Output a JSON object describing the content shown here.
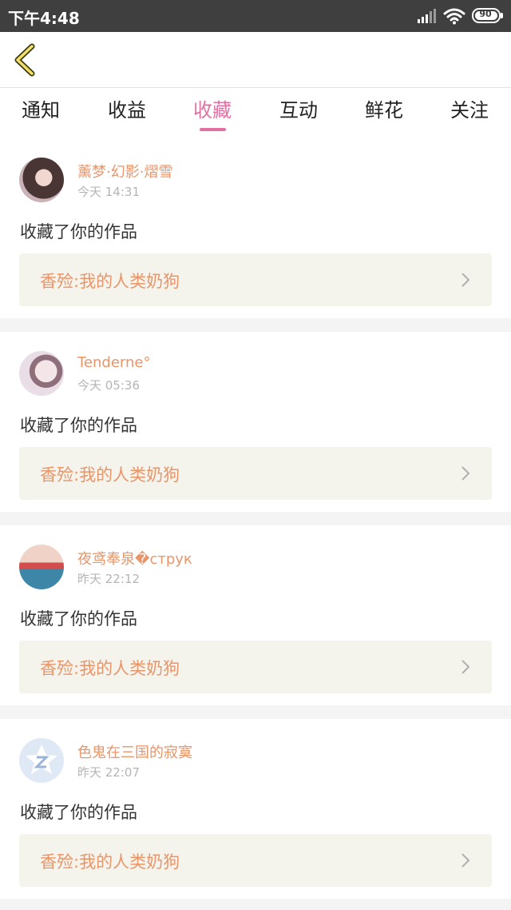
{
  "status_bar": {
    "time": "下午4:48",
    "battery": "90"
  },
  "tabs": [
    {
      "label": "通知"
    },
    {
      "label": "收益"
    },
    {
      "label": "收藏"
    },
    {
      "label": "互动"
    },
    {
      "label": "鲜花"
    },
    {
      "label": "关注"
    }
  ],
  "active_tab": "收藏",
  "colors": {
    "accent_pink": "#e271a3",
    "accent_orange": "#e9956a",
    "status_bar": "#3f3f3f",
    "card_bg": "#f5f4ec"
  },
  "feed": [
    {
      "user": "薰梦·幻影·熠雪",
      "time": "今天 14:31",
      "action": "收藏了你的作品",
      "work": "香殓:我的人类奶狗"
    },
    {
      "user": "Tenderne°",
      "time": "今天 05:36",
      "action": "收藏了你的作品",
      "work": "香殓:我的人类奶狗"
    },
    {
      "user": "夜鸢奉泉�струк",
      "time": "昨天 22:12",
      "action": "收藏了你的作品",
      "work": "香殓:我的人类奶狗"
    },
    {
      "user": "色鬼在三国的寂寞",
      "time": "昨天 22:07",
      "action": "收藏了你的作品",
      "work": "香殓:我的人类奶狗"
    }
  ]
}
